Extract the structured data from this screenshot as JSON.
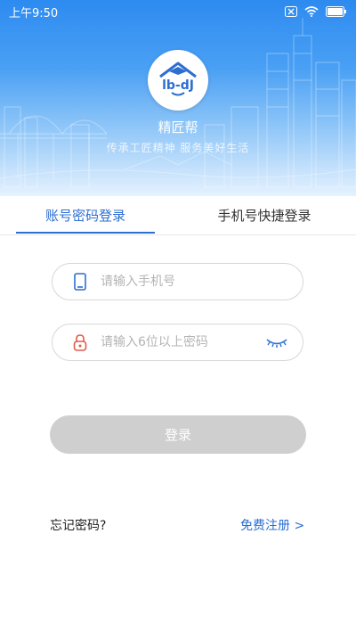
{
  "status_bar": {
    "time": "上午9:50",
    "icons": [
      "sim-x-icon",
      "wifi-icon",
      "battery-icon"
    ]
  },
  "header": {
    "logo_text": "lb-dJ",
    "app_name": "精匠帮",
    "slogan": "传承工匠精神  服务美好生活"
  },
  "tabs": [
    {
      "label": "账号密码登录",
      "active": true
    },
    {
      "label": "手机号快捷登录",
      "active": false
    }
  ],
  "form": {
    "phone_placeholder": "请输入手机号",
    "password_placeholder": "请输入6位以上密码",
    "login_label": "登录"
  },
  "links": {
    "forgot_password": "忘记密码?",
    "register": "免费注册 >"
  },
  "colors": {
    "primary": "#2c6fd1",
    "header_gradient_top": "#2d8bf0",
    "button_disabled": "#cfcfcf"
  }
}
